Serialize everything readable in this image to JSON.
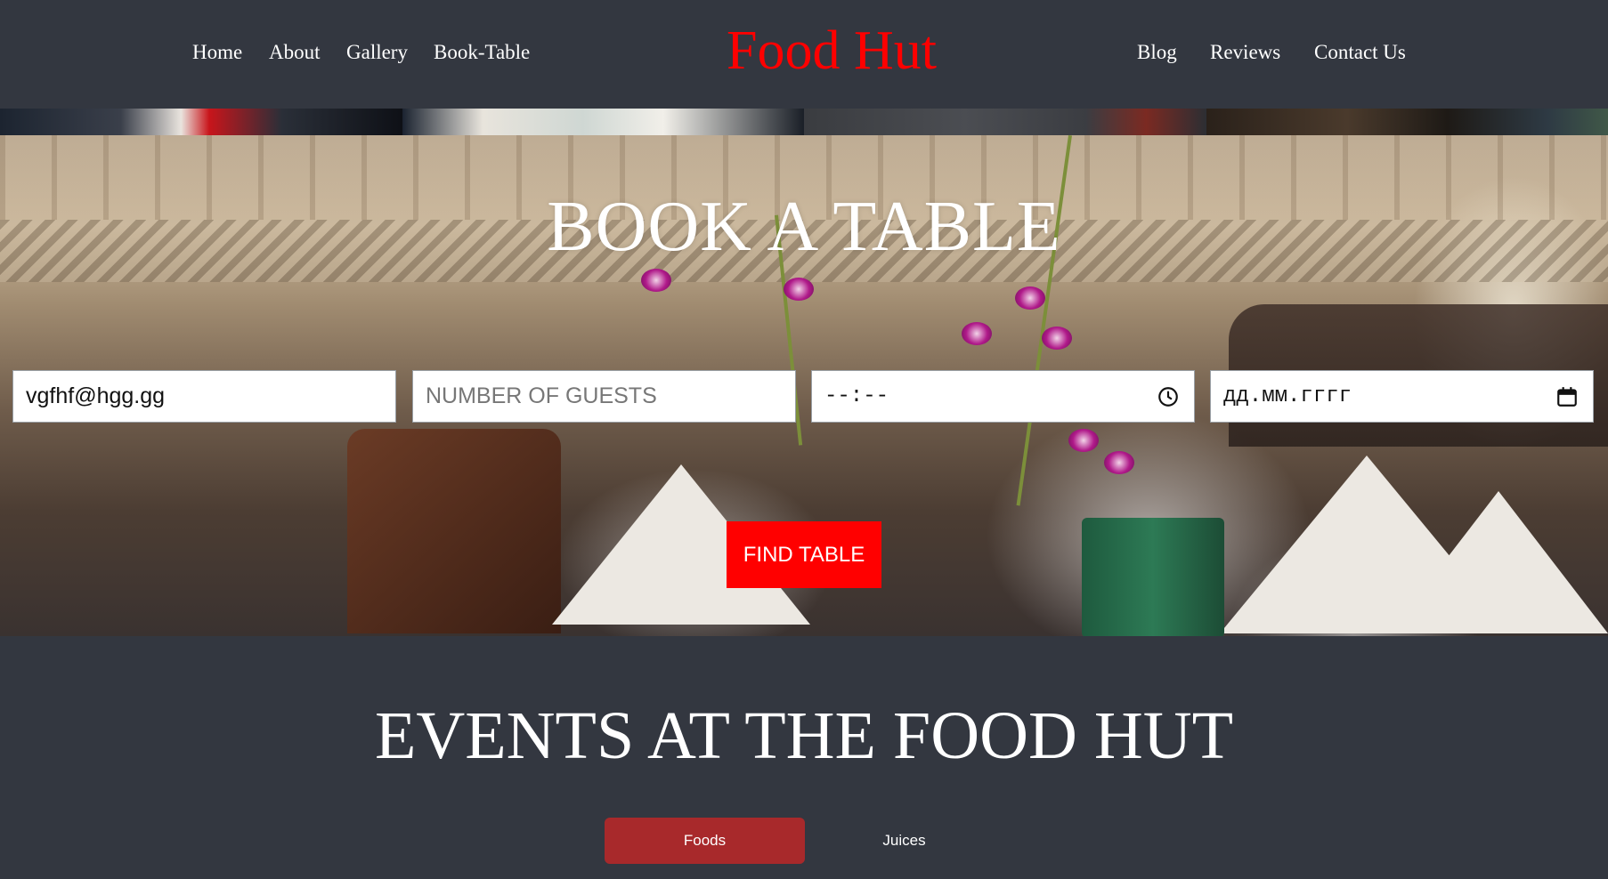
{
  "nav": {
    "left_links": [
      "Home",
      "About",
      "Gallery",
      "Book-Table"
    ],
    "brand": "Food Hut",
    "right_links": [
      "Blog",
      "Reviews",
      "Contact Us"
    ]
  },
  "hero": {
    "title": "BOOK A TABLE",
    "form": {
      "email_value": "vgfhf@hgg.gg",
      "guests_placeholder": "NUMBER OF GUESTS",
      "time_value": "--:--",
      "date_value": "дд.мм.гггг"
    },
    "find_button": "FIND TABLE"
  },
  "events": {
    "title": "EVENTS AT THE FOOD HUT",
    "tabs": [
      "Foods",
      "Juices"
    ],
    "active_tab": "Foods"
  },
  "colors": {
    "background": "#333740",
    "brand": "#ff0000",
    "button": "#ff0000",
    "active_tab": "#a8292b"
  },
  "icons": [
    "clock-icon",
    "calendar-icon"
  ]
}
